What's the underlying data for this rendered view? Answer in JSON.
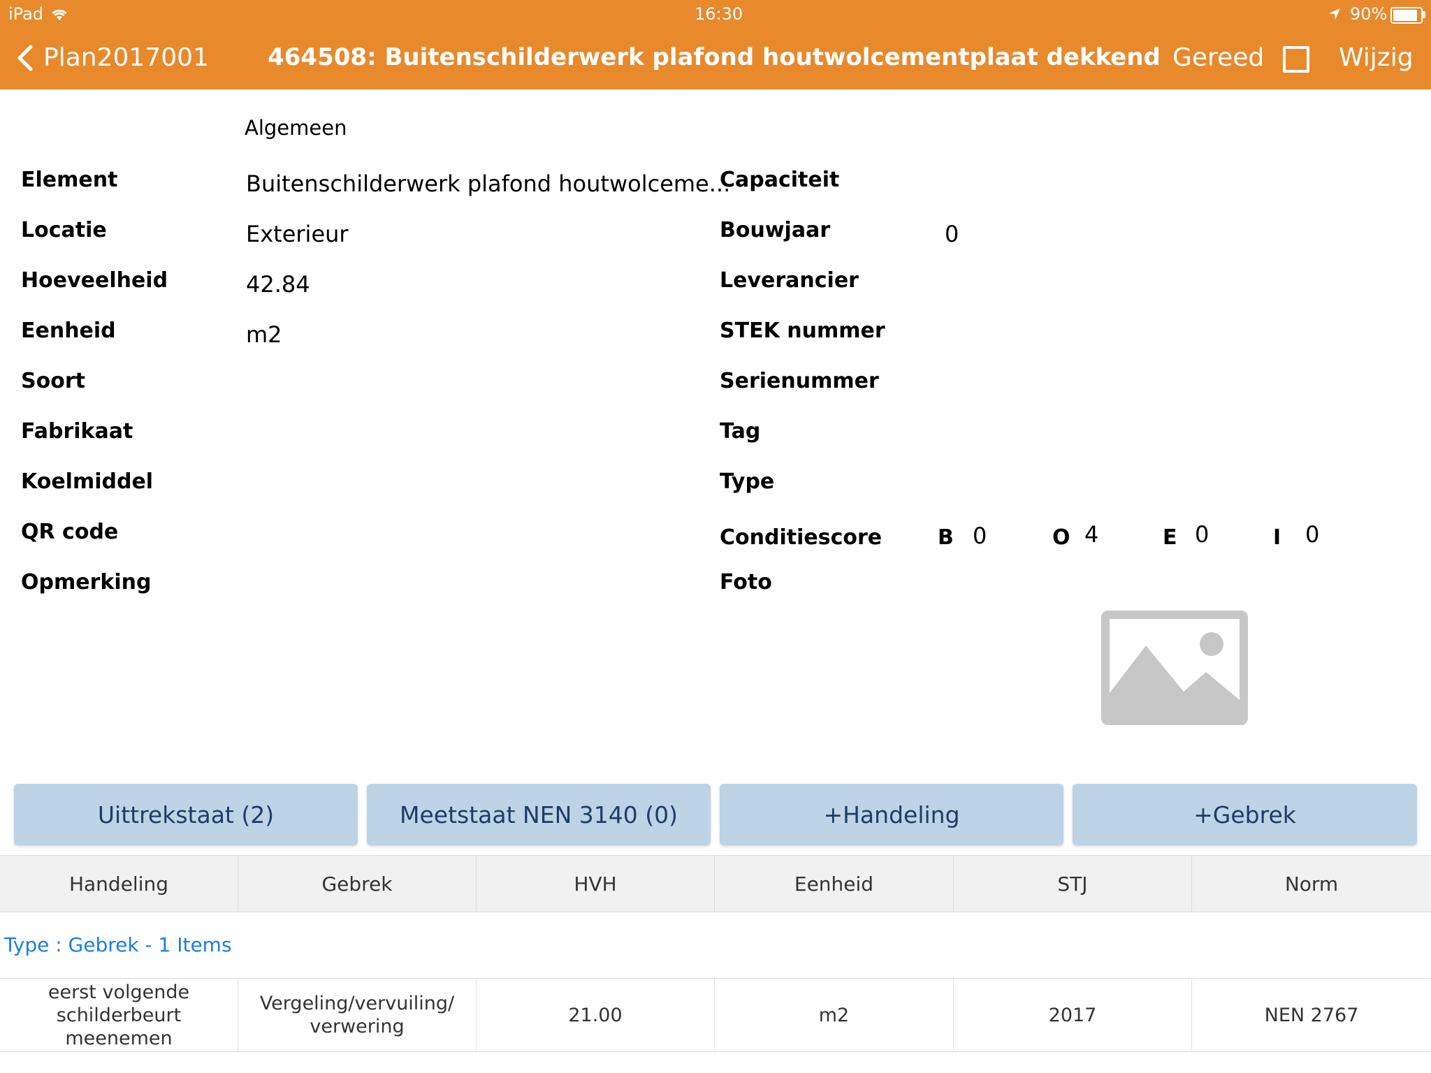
{
  "status_bar": {
    "device": "iPad",
    "time": "16:30",
    "battery": "90%",
    "battery_level": 0.9
  },
  "nav": {
    "back_label": "Plan2017001",
    "title": "464508: Buitenschilderwerk plafond houtwolcementplaat dekkend",
    "done_label": "Gereed",
    "edit_label": "Wijzig",
    "checkbox_checked": false
  },
  "section_title": "Algemeen",
  "left_fields": [
    {
      "label": "Element",
      "value": "Buitenschilderwerk plafond houtwolceme..."
    },
    {
      "label": "Locatie",
      "value": "Exterieur"
    },
    {
      "label": "Hoeveelheid",
      "value": "42.84"
    },
    {
      "label": "Eenheid",
      "value": "m2"
    },
    {
      "label": "Soort",
      "value": ""
    },
    {
      "label": "Fabrikaat",
      "value": ""
    },
    {
      "label": "Koelmiddel",
      "value": ""
    },
    {
      "label": "QR code",
      "value": ""
    },
    {
      "label": "Opmerking",
      "value": ""
    }
  ],
  "right_fields": [
    {
      "label": "Capaciteit",
      "value": ""
    },
    {
      "label": "Bouwjaar",
      "value": "0"
    },
    {
      "label": "Leverancier",
      "value": ""
    },
    {
      "label": "STEK nummer",
      "value": ""
    },
    {
      "label": "Serienummer",
      "value": ""
    },
    {
      "label": "Tag",
      "value": ""
    },
    {
      "label": "Type",
      "value": ""
    }
  ],
  "conditie": {
    "label": "Conditiescore",
    "scores": [
      {
        "letter": "B",
        "value": "0"
      },
      {
        "letter": "O",
        "value": "4"
      },
      {
        "letter": "E",
        "value": "0"
      },
      {
        "letter": "I",
        "value": "0"
      }
    ]
  },
  "foto_label": "Foto",
  "photo_icon": "image-placeholder-icon",
  "buttons": [
    {
      "label": "Uittrekstaat (2)"
    },
    {
      "label": "Meetstaat NEN 3140 (0)"
    },
    {
      "label": "+Handeling"
    },
    {
      "label": "+Gebrek"
    }
  ],
  "table": {
    "headers": [
      "Handeling",
      "Gebrek",
      "HVH",
      "Eenheid",
      "STJ",
      "Norm"
    ],
    "group_label": "Type : Gebrek - 1 Items",
    "rows": [
      [
        "eerst volgende schilderbeurt meenemen",
        "Vergeling/vervuiling/ verwering",
        "21.00",
        "m2",
        "2017",
        "NEN 2767"
      ]
    ]
  },
  "colors": {
    "nav_bg": "#E8892C",
    "button_bg": "#BDD3E6",
    "button_text": "#1c3d68",
    "link_blue": "#1a7ee6"
  }
}
